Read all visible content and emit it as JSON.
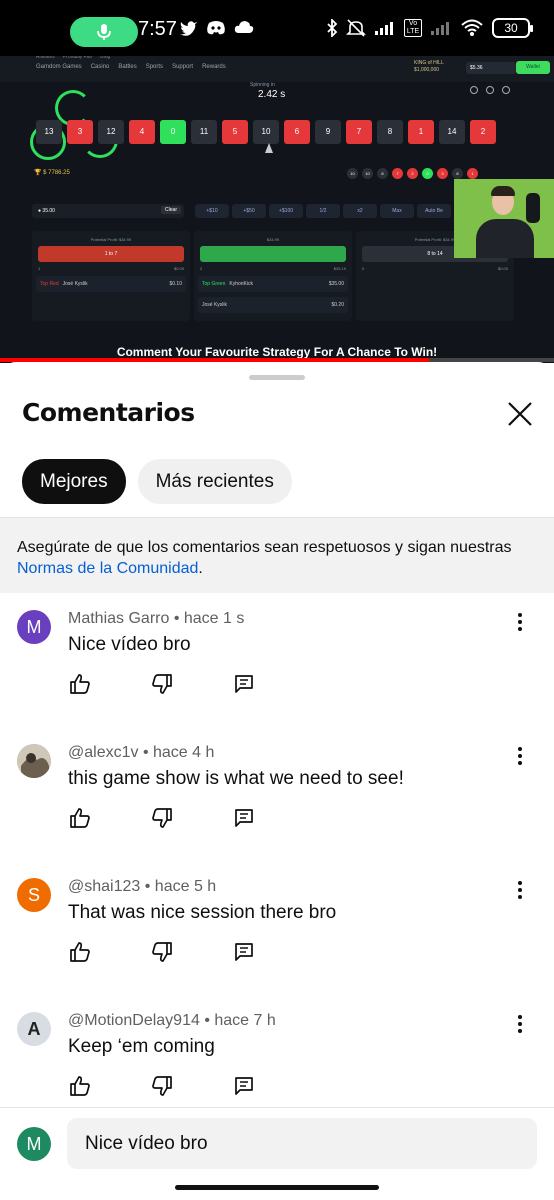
{
  "status_bar": {
    "time": "7:57",
    "battery": "30",
    "network": "Vo LTE"
  },
  "video": {
    "caption": "Comment Your Favourite Strategy For A Chance To Win!",
    "progress_fraction": 0.775,
    "site_links": [
      "Gamdom Games",
      "Casino",
      "Battles",
      "Sports",
      "Support",
      "Rewards"
    ],
    "site_sublinks": [
      "Affiliates",
      "Provably Fair",
      "Blog"
    ],
    "brand": "KING of HILL",
    "prize": "$1,000,000",
    "balance": "$5.36",
    "wallet_label": "Wallet",
    "spinning_label": "Spinning in",
    "spinning_time": "2.42 s",
    "tiles": [
      {
        "n": "13",
        "c": "b"
      },
      {
        "n": "3",
        "c": "r"
      },
      {
        "n": "12",
        "c": "b"
      },
      {
        "n": "4",
        "c": "r"
      },
      {
        "n": "0",
        "c": "g"
      },
      {
        "n": "11",
        "c": "b"
      },
      {
        "n": "5",
        "c": "r"
      },
      {
        "n": "10",
        "c": "b"
      },
      {
        "n": "6",
        "c": "r"
      },
      {
        "n": "9",
        "c": "b"
      },
      {
        "n": "7",
        "c": "r"
      },
      {
        "n": "8",
        "c": "b"
      },
      {
        "n": "1",
        "c": "r"
      },
      {
        "n": "14",
        "c": "b"
      },
      {
        "n": "2",
        "c": "r"
      }
    ],
    "trophy_amount": "$ 7786.25",
    "recent": [
      {
        "n": "10",
        "c": "b"
      },
      {
        "n": "10",
        "c": "b"
      },
      {
        "n": "8",
        "c": "b"
      },
      {
        "n": "7",
        "c": "r"
      },
      {
        "n": "2",
        "c": "r"
      },
      {
        "n": "0",
        "c": "g"
      },
      {
        "n": "3",
        "c": "r"
      },
      {
        "n": "8",
        "c": "b"
      },
      {
        "n": "1",
        "c": "r"
      }
    ],
    "bet_amount": "35.00",
    "clear_label": "Clear",
    "bet_buttons": [
      "+$10",
      "+$50",
      "+$100",
      "1/2",
      "x2",
      "Max",
      "Auto Be"
    ],
    "columns": [
      {
        "profit": "Potential Profit: $34.99",
        "label": "1 to 7",
        "color": "#c0392b",
        "top_label": "Top Red",
        "player": "José Kyslik",
        "level": "37",
        "amount": "$0.10",
        "count": "1",
        "sum": "$0.09"
      },
      {
        "profit": "$34.99",
        "label": "",
        "color": "#2ea84a",
        "top_label": "Top Green",
        "player": "KyhonKick",
        "level": "126",
        "amount": "$35.00",
        "count": "2",
        "sum": "$35.19",
        "player2": "José Kyslik",
        "amount2": "$0.20"
      },
      {
        "profit": "Potential Profit: $34.99",
        "label": "8 to 14",
        "color": "#2b3038",
        "count": "0",
        "sum": "$0.00"
      }
    ]
  },
  "sheet": {
    "title": "Comentarios",
    "tabs": [
      {
        "label": "Mejores",
        "active": true
      },
      {
        "label": "Más recientes",
        "active": false
      }
    ],
    "notice_text": "Asegúrate de que los comentarios sean respetuosos y sigan nuestras ",
    "notice_link": "Normas de la Comunidad",
    "notice_end": "."
  },
  "comments": [
    {
      "author": "Mathias Garro",
      "time": "hace 1 s",
      "text": "Nice vídeo bro",
      "avatar_letter": "M",
      "avatar_color": "#6a3fbf"
    },
    {
      "author": "@alexc1v",
      "time": "hace 4 h",
      "text": "this game show is what we need to see!",
      "avatar_letter": "",
      "avatar_color": "#b8b0a0"
    },
    {
      "author": "@shai123",
      "time": "hace 5 h",
      "text": "That was nice session there bro",
      "avatar_letter": "S",
      "avatar_color": "#ef6c00"
    },
    {
      "author": "@MotionDelay914",
      "time": "hace 7 h",
      "text": "Keep ‘em coming",
      "avatar_letter": "A",
      "avatar_color": "#d8dde3"
    }
  ],
  "composer": {
    "avatar_letter": "M",
    "value": "Nice vídeo bro"
  }
}
